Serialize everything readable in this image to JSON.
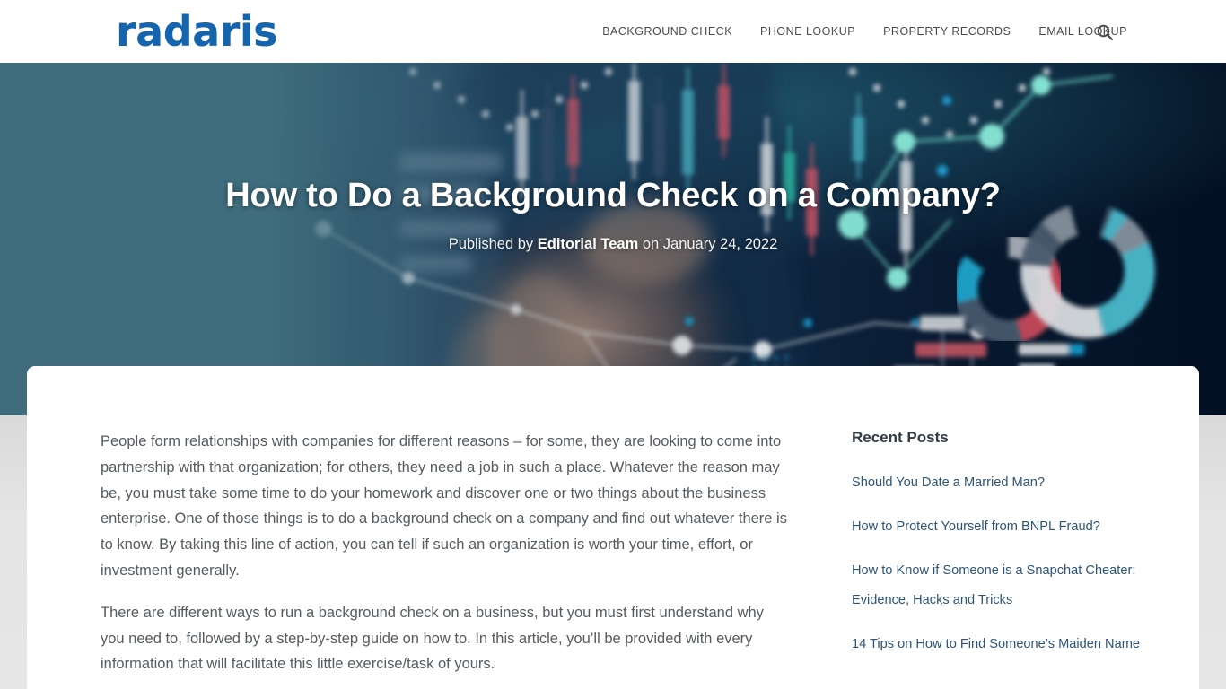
{
  "header": {
    "logo_text": "radaris",
    "logo_color": "#1464ae",
    "nav": [
      {
        "label": "BACKGROUND CHECK"
      },
      {
        "label": "PHONE LOOKUP"
      },
      {
        "label": "PROPERTY RECORDS"
      },
      {
        "label": "EMAIL LOOKUP"
      }
    ],
    "search_icon": "search-icon"
  },
  "hero": {
    "title": "How to Do a Background Check on a Company?",
    "meta_prefix": "Published by ",
    "meta_author": "Editorial Team",
    "meta_suffix": " on January 24, 2022",
    "overlay_color": "#3f6d7d",
    "image_description": "businessman touching floating financial data charts"
  },
  "article": {
    "paragraphs": [
      "People form relationships with companies for different reasons – for some, they are looking to come into partnership with that organization; for others, they need a job in such a place. Whatever the reason may be, you must take some time to do your homework and discover one or two things about the business enterprise. One of those things is to do a background check on a company and find out whatever there is to know. By taking this line of action, you can tell if such an organization is worth your time, effort, or investment generally.",
      "There are different ways to run a background check on a business, but you must first understand why you need to, followed by a step-by-step guide on how to. In this article, you’ll be provided with every information that will facilitate this little exercise/task of yours."
    ]
  },
  "sidebar": {
    "heading": "Recent Posts",
    "link_color": "#2d5578",
    "recent_posts": [
      {
        "label": "Should You Date a Married Man?"
      },
      {
        "label": "How to Protect Yourself from BNPL Fraud?"
      },
      {
        "label": "How to Know if Someone is a Snapchat Cheater: Evidence, Hacks and Tricks"
      },
      {
        "label": "14 Tips on How to Find Someone’s Maiden Name"
      }
    ]
  }
}
